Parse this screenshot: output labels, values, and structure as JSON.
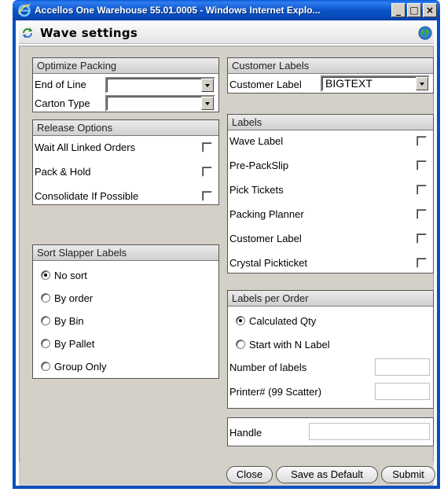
{
  "window": {
    "title": "Accellos One Warehouse 55.01.0005 - Windows Internet Explo...",
    "minimize_label": "_",
    "maximize_label": "□",
    "close_label": "×"
  },
  "dialog": {
    "title": "Wave settings"
  },
  "optimize_packing": {
    "title": "Optimize Packing",
    "end_of_line": {
      "label": "End of Line",
      "value": ""
    },
    "carton_type": {
      "label": "Carton Type",
      "value": ""
    }
  },
  "release_options": {
    "title": "Release Options",
    "items": [
      {
        "label": "Wait All Linked Orders",
        "checked": false
      },
      {
        "label": "Pack & Hold",
        "checked": false
      },
      {
        "label": "Consolidate If Possible",
        "checked": false
      }
    ]
  },
  "sort_slapper": {
    "title": "Sort Slapper Labels",
    "options": [
      {
        "label": "No sort",
        "checked": true
      },
      {
        "label": "By order",
        "checked": false
      },
      {
        "label": "By Bin",
        "checked": false
      },
      {
        "label": "By Pallet",
        "checked": false
      },
      {
        "label": "Group Only",
        "checked": false
      }
    ]
  },
  "customer_labels": {
    "title": "Customer Labels",
    "label": "Customer Label",
    "value": "BIGTEXT"
  },
  "labels": {
    "title": "Labels",
    "items": [
      {
        "label": "Wave Label",
        "checked": false
      },
      {
        "label": "Pre-PackSlip",
        "checked": false
      },
      {
        "label": "Pick Tickets",
        "checked": false
      },
      {
        "label": "Packing Planner",
        "checked": false
      },
      {
        "label": "Customer Label",
        "checked": false
      },
      {
        "label": "Crystal Pickticket",
        "checked": false
      }
    ]
  },
  "labels_per_order": {
    "title": "Labels per Order",
    "options": [
      {
        "label": "Calculated Qty",
        "checked": true
      },
      {
        "label": "Start with N Label",
        "checked": false
      }
    ],
    "number_of_labels": {
      "label": "Number of labels",
      "value": ""
    },
    "printer": {
      "label": "Printer# (99 Scatter)",
      "value": ""
    }
  },
  "handle": {
    "label": "Handle",
    "value": ""
  },
  "footer": {
    "close_label": "Close",
    "save_default_label": "Save as Default",
    "submit_label": "Submit"
  },
  "colors": {
    "titlebar": "#0b54c8",
    "panel_bg": "#d4d0c8",
    "group_header": "#cfcfcf"
  }
}
